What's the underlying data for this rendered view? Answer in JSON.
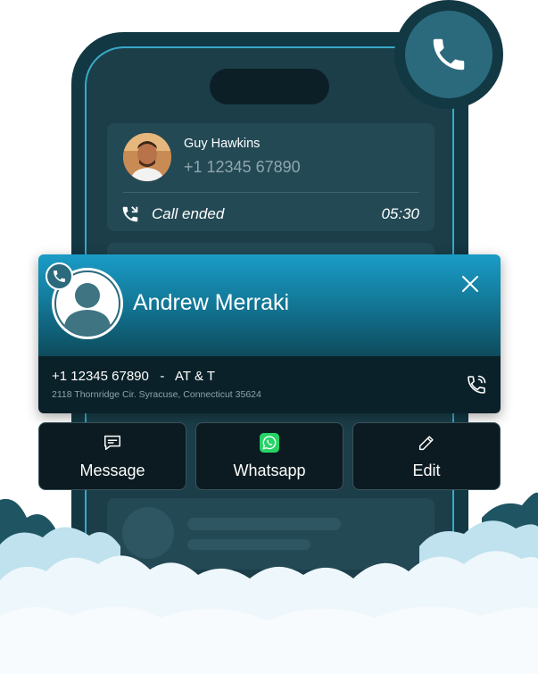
{
  "recent_call": {
    "name": "Guy Hawkins",
    "phone": "+1 12345 67890",
    "status": "Call ended",
    "duration": "05:30",
    "status_icon": "missed-call-icon"
  },
  "caller": {
    "name": "Andrew Merraki",
    "phone_line": "+1 12345 67890   -   AT & T",
    "address": "2118 Thornridge Cir. Syracuse, Connecticut 35624",
    "badge_icon": "phone-icon",
    "close_icon": "close-icon",
    "callback_icon": "phone-call-icon"
  },
  "actions": [
    {
      "label": "Message",
      "icon": "message-icon"
    },
    {
      "label": "Whatsapp",
      "icon": "whatsapp-icon"
    },
    {
      "label": "Edit",
      "icon": "pencil-icon"
    }
  ],
  "colors": {
    "phone_body": "#123843",
    "accent": "#1a9cc7",
    "whatsapp": "#25d366",
    "cloud": "#eef7fb",
    "cloud_shadow": "#bfe2ee",
    "cloud_dark": "#1f5563"
  }
}
